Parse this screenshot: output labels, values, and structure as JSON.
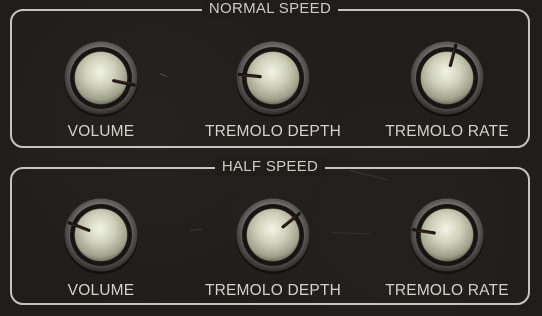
{
  "sections": [
    {
      "title": "NORMAL SPEED",
      "knobs": [
        {
          "label": "VOLUME",
          "value": 0.84
        },
        {
          "label": "TREMOLO DEPTH",
          "value": 0.22
        },
        {
          "label": "TREMOLO RATE",
          "value": 0.55
        }
      ]
    },
    {
      "title": "HALF SPEED",
      "knobs": [
        {
          "label": "VOLUME",
          "value": 0.27
        },
        {
          "label": "TREMOLO DEPTH",
          "value": 0.67
        },
        {
          "label": "TREMOLO RATE",
          "value": 0.23
        }
      ]
    }
  ],
  "colors": {
    "background": "#211d1b",
    "outline": "#c8c4bd",
    "label": "#d6d2cb",
    "knob_cap": "#c9cbb5",
    "pointer": "#1a1614"
  }
}
